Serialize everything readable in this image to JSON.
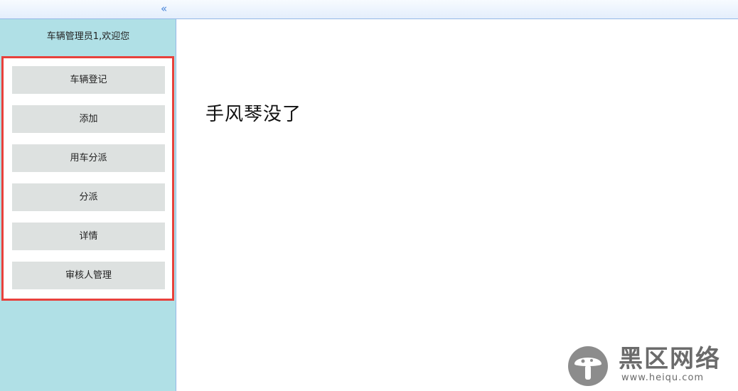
{
  "sidebar": {
    "collapse_glyph": "«",
    "welcome": "车辆管理员1,欢迎您",
    "menu": [
      {
        "label": "车辆登记"
      },
      {
        "label": "添加"
      },
      {
        "label": "用车分派"
      },
      {
        "label": "分派"
      },
      {
        "label": "详情"
      },
      {
        "label": "审核人管理"
      }
    ]
  },
  "main": {
    "text": "手风琴没了"
  },
  "watermark": {
    "title": "黑区网络",
    "url": "www.heiqu.com"
  },
  "colors": {
    "sidebar_bg": "#b0e0e6",
    "highlight_border": "#e8413c",
    "menu_item_bg": "#dde1e0",
    "header_border": "#95b8e7"
  }
}
